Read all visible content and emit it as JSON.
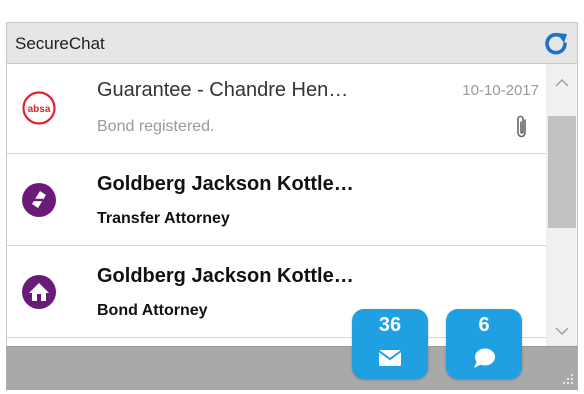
{
  "app": {
    "title": "SecureChat"
  },
  "colors": {
    "accent": "#1ea0e3",
    "absa_red": "#e3202f",
    "purple": "#6a1b78"
  },
  "messages": [
    {
      "icon": "absa-logo",
      "logo_text": "absa",
      "title": "Guarantee - Chandre Hen…",
      "subtitle": "Bond registered.",
      "date": "10-10-2017",
      "attachment": true
    },
    {
      "icon": "transfer-icon",
      "title": "Goldberg Jackson Kottle…",
      "subtitle": "Transfer Attorney"
    },
    {
      "icon": "home-icon",
      "title": "Goldberg Jackson Kottle…",
      "subtitle": "Bond Attorney"
    }
  ],
  "badges": {
    "mail_count": "36",
    "chat_count": "6"
  }
}
